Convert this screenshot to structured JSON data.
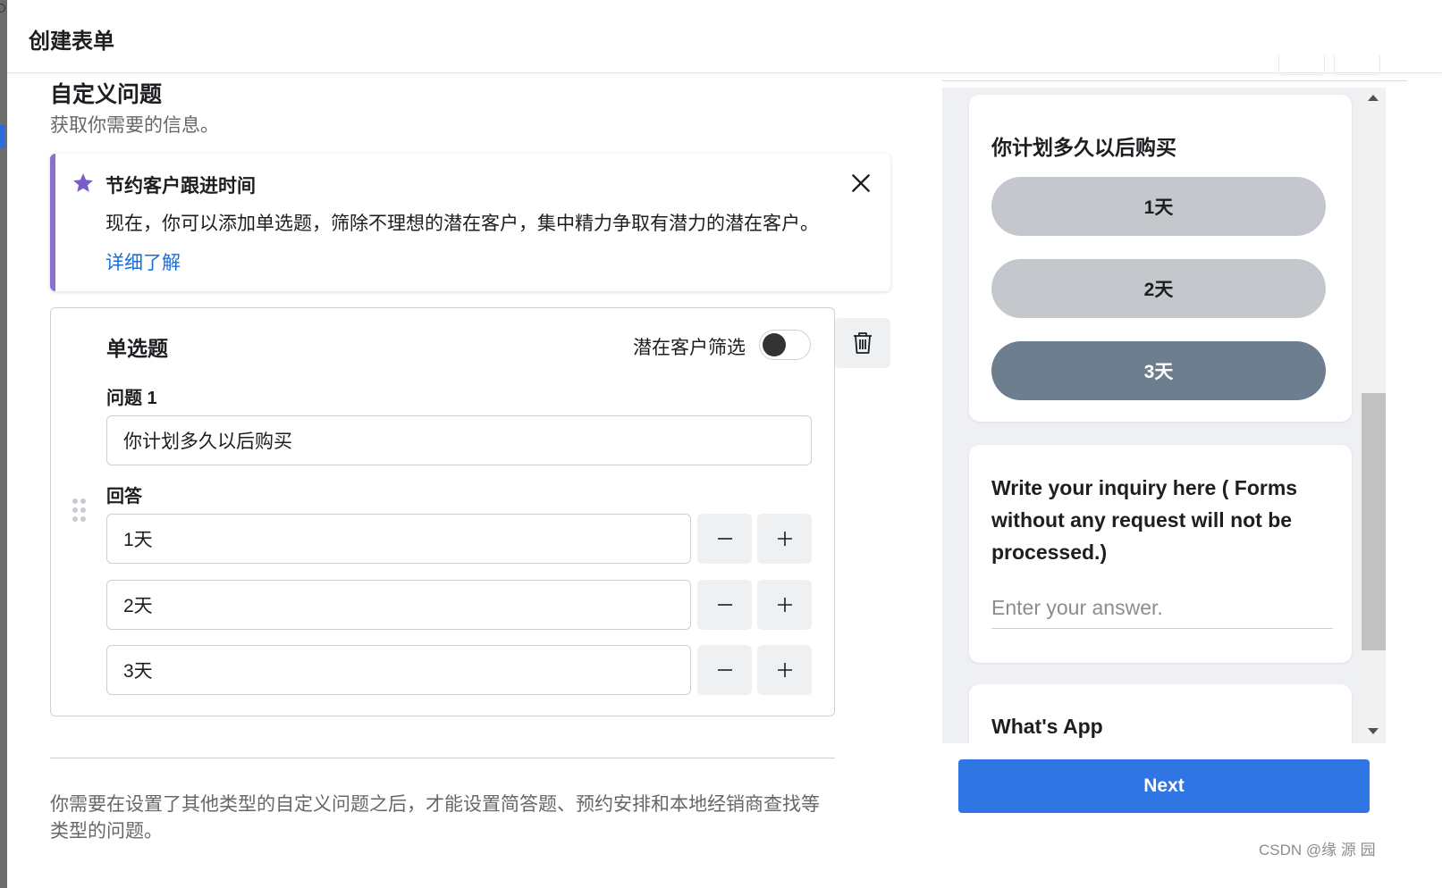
{
  "dialog": {
    "title": "创建表单"
  },
  "section": {
    "title": "自定义问题",
    "subtitle": "获取你需要的信息。"
  },
  "tip": {
    "title": "节约客户跟进时间",
    "body": "现在，你可以添加单选题，筛除不理想的潜在客户，集中精力争取有潜力的潜在客户。",
    "link": "详细了解",
    "accent_color": "#8a6fd1"
  },
  "question": {
    "type_label": "单选题",
    "filter_label": "潜在客户筛选",
    "question_label": "问题 1",
    "question_value": "你计划多久以后购买",
    "answers_label": "回答",
    "answers": [
      {
        "value": "1天"
      },
      {
        "value": "2天"
      },
      {
        "value": "3天"
      }
    ]
  },
  "footer_note": "你需要在设置了其他类型的自定义问题之后，才能设置简答题、预约安排和本地经销商查找等类型的问题。",
  "preview": {
    "question1": "你计划多久以后购买",
    "options": [
      "1天",
      "2天",
      "3天"
    ],
    "selected_option": "3天",
    "question2": "Write your inquiry here ( Forms without any request will not be processed.)",
    "answer_placeholder": "Enter your answer.",
    "question3": "What's App"
  },
  "next_button": "Next",
  "watermark": "CSDN @缘 源 园",
  "colors": {
    "primary_button": "#2f75e4",
    "link": "#1a6ed8",
    "selected_option": "#6e7e8e"
  }
}
